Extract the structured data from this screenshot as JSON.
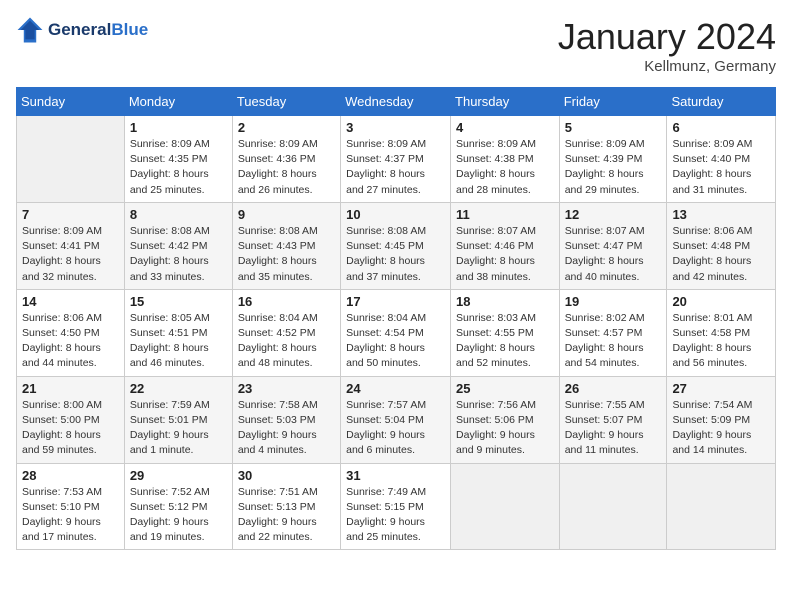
{
  "header": {
    "logo_line1": "General",
    "logo_line2": "Blue",
    "month": "January 2024",
    "location": "Kellmunz, Germany"
  },
  "weekdays": [
    "Sunday",
    "Monday",
    "Tuesday",
    "Wednesday",
    "Thursday",
    "Friday",
    "Saturday"
  ],
  "weeks": [
    [
      {
        "day": "",
        "info": ""
      },
      {
        "day": "1",
        "info": "Sunrise: 8:09 AM\nSunset: 4:35 PM\nDaylight: 8 hours\nand 25 minutes."
      },
      {
        "day": "2",
        "info": "Sunrise: 8:09 AM\nSunset: 4:36 PM\nDaylight: 8 hours\nand 26 minutes."
      },
      {
        "day": "3",
        "info": "Sunrise: 8:09 AM\nSunset: 4:37 PM\nDaylight: 8 hours\nand 27 minutes."
      },
      {
        "day": "4",
        "info": "Sunrise: 8:09 AM\nSunset: 4:38 PM\nDaylight: 8 hours\nand 28 minutes."
      },
      {
        "day": "5",
        "info": "Sunrise: 8:09 AM\nSunset: 4:39 PM\nDaylight: 8 hours\nand 29 minutes."
      },
      {
        "day": "6",
        "info": "Sunrise: 8:09 AM\nSunset: 4:40 PM\nDaylight: 8 hours\nand 31 minutes."
      }
    ],
    [
      {
        "day": "7",
        "info": "Sunrise: 8:09 AM\nSunset: 4:41 PM\nDaylight: 8 hours\nand 32 minutes."
      },
      {
        "day": "8",
        "info": "Sunrise: 8:08 AM\nSunset: 4:42 PM\nDaylight: 8 hours\nand 33 minutes."
      },
      {
        "day": "9",
        "info": "Sunrise: 8:08 AM\nSunset: 4:43 PM\nDaylight: 8 hours\nand 35 minutes."
      },
      {
        "day": "10",
        "info": "Sunrise: 8:08 AM\nSunset: 4:45 PM\nDaylight: 8 hours\nand 37 minutes."
      },
      {
        "day": "11",
        "info": "Sunrise: 8:07 AM\nSunset: 4:46 PM\nDaylight: 8 hours\nand 38 minutes."
      },
      {
        "day": "12",
        "info": "Sunrise: 8:07 AM\nSunset: 4:47 PM\nDaylight: 8 hours\nand 40 minutes."
      },
      {
        "day": "13",
        "info": "Sunrise: 8:06 AM\nSunset: 4:48 PM\nDaylight: 8 hours\nand 42 minutes."
      }
    ],
    [
      {
        "day": "14",
        "info": "Sunrise: 8:06 AM\nSunset: 4:50 PM\nDaylight: 8 hours\nand 44 minutes."
      },
      {
        "day": "15",
        "info": "Sunrise: 8:05 AM\nSunset: 4:51 PM\nDaylight: 8 hours\nand 46 minutes."
      },
      {
        "day": "16",
        "info": "Sunrise: 8:04 AM\nSunset: 4:52 PM\nDaylight: 8 hours\nand 48 minutes."
      },
      {
        "day": "17",
        "info": "Sunrise: 8:04 AM\nSunset: 4:54 PM\nDaylight: 8 hours\nand 50 minutes."
      },
      {
        "day": "18",
        "info": "Sunrise: 8:03 AM\nSunset: 4:55 PM\nDaylight: 8 hours\nand 52 minutes."
      },
      {
        "day": "19",
        "info": "Sunrise: 8:02 AM\nSunset: 4:57 PM\nDaylight: 8 hours\nand 54 minutes."
      },
      {
        "day": "20",
        "info": "Sunrise: 8:01 AM\nSunset: 4:58 PM\nDaylight: 8 hours\nand 56 minutes."
      }
    ],
    [
      {
        "day": "21",
        "info": "Sunrise: 8:00 AM\nSunset: 5:00 PM\nDaylight: 8 hours\nand 59 minutes."
      },
      {
        "day": "22",
        "info": "Sunrise: 7:59 AM\nSunset: 5:01 PM\nDaylight: 9 hours\nand 1 minute."
      },
      {
        "day": "23",
        "info": "Sunrise: 7:58 AM\nSunset: 5:03 PM\nDaylight: 9 hours\nand 4 minutes."
      },
      {
        "day": "24",
        "info": "Sunrise: 7:57 AM\nSunset: 5:04 PM\nDaylight: 9 hours\nand 6 minutes."
      },
      {
        "day": "25",
        "info": "Sunrise: 7:56 AM\nSunset: 5:06 PM\nDaylight: 9 hours\nand 9 minutes."
      },
      {
        "day": "26",
        "info": "Sunrise: 7:55 AM\nSunset: 5:07 PM\nDaylight: 9 hours\nand 11 minutes."
      },
      {
        "day": "27",
        "info": "Sunrise: 7:54 AM\nSunset: 5:09 PM\nDaylight: 9 hours\nand 14 minutes."
      }
    ],
    [
      {
        "day": "28",
        "info": "Sunrise: 7:53 AM\nSunset: 5:10 PM\nDaylight: 9 hours\nand 17 minutes."
      },
      {
        "day": "29",
        "info": "Sunrise: 7:52 AM\nSunset: 5:12 PM\nDaylight: 9 hours\nand 19 minutes."
      },
      {
        "day": "30",
        "info": "Sunrise: 7:51 AM\nSunset: 5:13 PM\nDaylight: 9 hours\nand 22 minutes."
      },
      {
        "day": "31",
        "info": "Sunrise: 7:49 AM\nSunset: 5:15 PM\nDaylight: 9 hours\nand 25 minutes."
      },
      {
        "day": "",
        "info": ""
      },
      {
        "day": "",
        "info": ""
      },
      {
        "day": "",
        "info": ""
      }
    ]
  ]
}
